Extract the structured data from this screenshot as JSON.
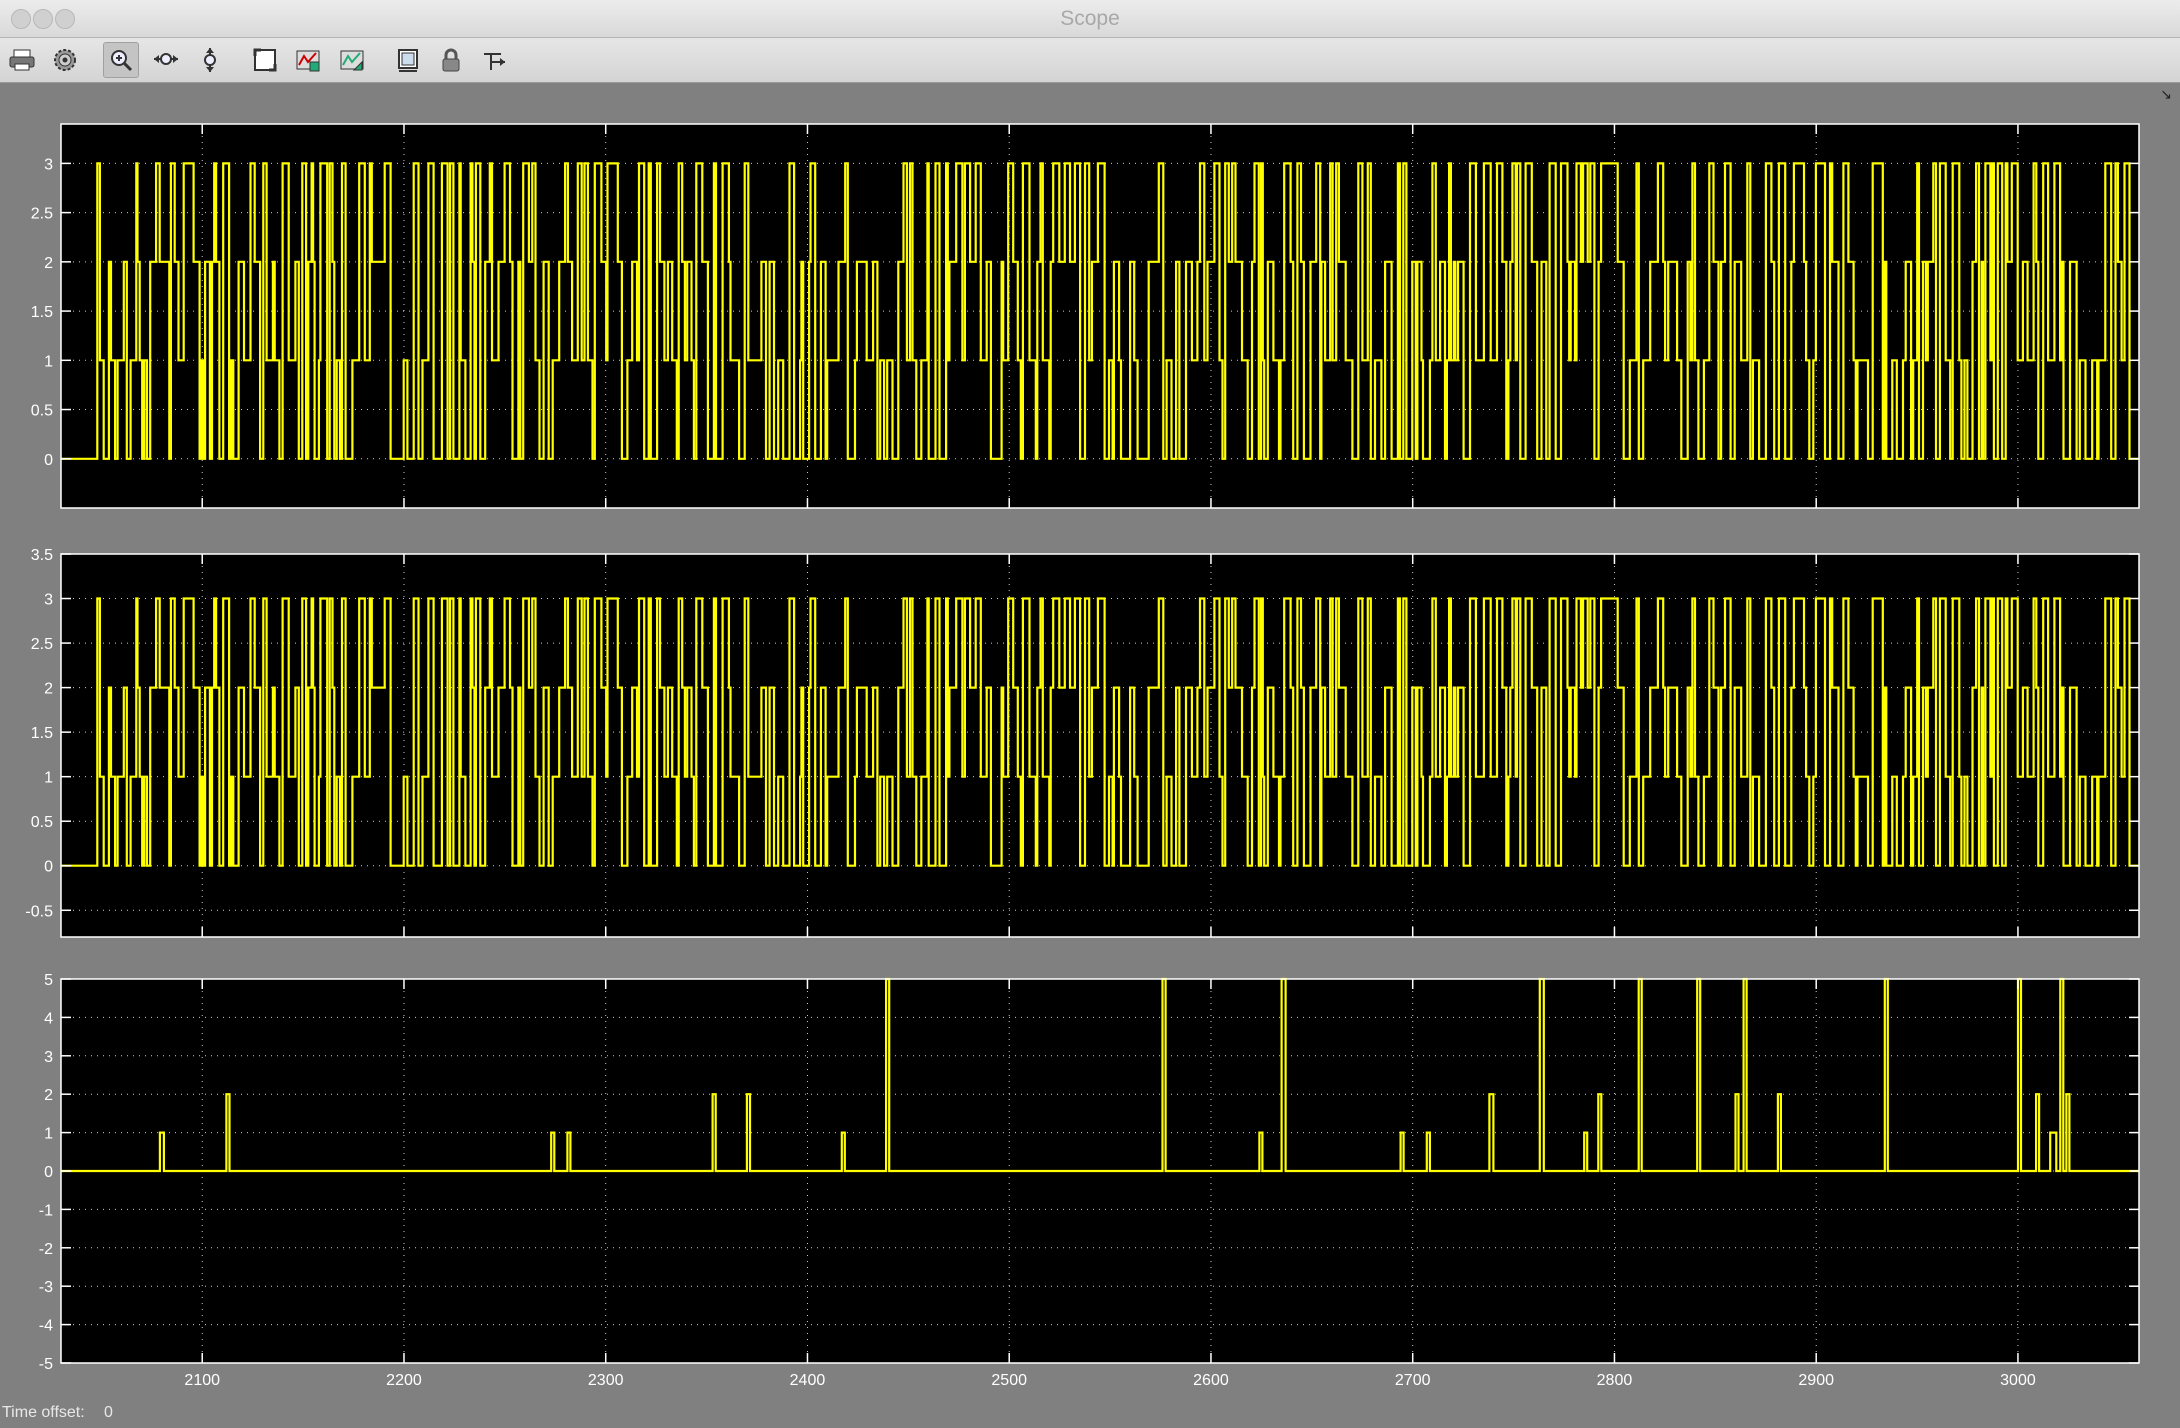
{
  "window": {
    "title": "Scope"
  },
  "toolbar": {
    "buttons": [
      {
        "id": "print",
        "icon": "printer-icon"
      },
      {
        "id": "parameters",
        "icon": "gear-icon"
      },
      {
        "id": "zoom",
        "icon": "zoom-in-icon",
        "active": true
      },
      {
        "id": "zoom-x",
        "icon": "zoom-x-axis-icon"
      },
      {
        "id": "zoom-y",
        "icon": "zoom-y-axis-icon"
      },
      {
        "id": "autoscale",
        "icon": "autoscale-icon"
      },
      {
        "id": "save-axes",
        "icon": "save-axes-settings-icon"
      },
      {
        "id": "restore-axes",
        "icon": "restore-axes-settings-icon"
      },
      {
        "id": "floating-scope",
        "icon": "floating-scope-icon"
      },
      {
        "id": "lock-axes",
        "icon": "lock-icon"
      },
      {
        "id": "signal-selection",
        "icon": "signal-selection-icon"
      }
    ],
    "more_icon": "overflow-arrow-icon"
  },
  "status": {
    "time_offset_label": "Time offset:",
    "time_offset_value": "0"
  },
  "colors": {
    "trace": "#ffff00",
    "axes_bg": "#000000",
    "figure_bg": "#808080",
    "grid": "#ffffff"
  },
  "chart_data": [
    {
      "type": "line",
      "title": "",
      "xlabel": "",
      "ylabel": "",
      "xlim": [
        2030,
        3060
      ],
      "ylim": [
        -0.5,
        3.4
      ],
      "xticks": [
        2100,
        2200,
        2300,
        2400,
        2500,
        2600,
        2700,
        2800,
        2900,
        3000
      ],
      "yticks": [
        0,
        0.5,
        1,
        1.5,
        2,
        2.5,
        3
      ],
      "ytick_labels": [
        "0",
        "0.5",
        "1",
        "1.5",
        "2",
        "2.5",
        "3"
      ],
      "show_xtick_labels": false,
      "grid": true,
      "step": true,
      "signal": {
        "description_free": true,
        "x_start": 2030,
        "x_end": 3060,
        "zero_until": 2048,
        "levels": [
          0,
          1,
          2,
          3
        ],
        "seed": 17
      }
    },
    {
      "type": "line",
      "title": "",
      "xlabel": "",
      "ylabel": "",
      "xlim": [
        2030,
        3060
      ],
      "ylim": [
        -0.8,
        3.5
      ],
      "xticks": [
        2100,
        2200,
        2300,
        2400,
        2500,
        2600,
        2700,
        2800,
        2900,
        3000
      ],
      "yticks": [
        -0.5,
        0,
        0.5,
        1,
        1.5,
        2,
        2.5,
        3,
        3.5
      ],
      "ytick_labels": [
        "-0.5",
        "0",
        "0.5",
        "1",
        "1.5",
        "2",
        "2.5",
        "3",
        "3.5"
      ],
      "show_xtick_labels": false,
      "grid": true,
      "step": true,
      "signal": {
        "x_start": 2030,
        "x_end": 3060,
        "zero_until": 2048,
        "levels": [
          0,
          1,
          2,
          3
        ],
        "seed": 17
      }
    },
    {
      "type": "line",
      "title": "",
      "xlabel": "",
      "ylabel": "",
      "xlim": [
        2030,
        3060
      ],
      "ylim": [
        -5,
        5
      ],
      "xticks": [
        2100,
        2200,
        2300,
        2400,
        2500,
        2600,
        2700,
        2800,
        2900,
        3000
      ],
      "xtick_labels": [
        "2100",
        "2200",
        "2300",
        "2400",
        "2500",
        "2600",
        "2700",
        "2800",
        "2900",
        "3000"
      ],
      "yticks": [
        -5,
        -4,
        -3,
        -2,
        -1,
        0,
        1,
        2,
        3,
        4,
        5
      ],
      "ytick_labels": [
        "-5",
        "-4",
        "-3",
        "-2",
        "-1",
        "0",
        "1",
        "2",
        "3",
        "4",
        "5"
      ],
      "show_xtick_labels": true,
      "grid": true,
      "step": true,
      "pulses": [
        {
          "x": 2079,
          "w": 2,
          "y": 1
        },
        {
          "x": 2112,
          "w": 1.5,
          "y": 2
        },
        {
          "x": 2273,
          "w": 1.5,
          "y": 1
        },
        {
          "x": 2281,
          "w": 1.5,
          "y": 1
        },
        {
          "x": 2353,
          "w": 1.5,
          "y": 2
        },
        {
          "x": 2370,
          "w": 1.5,
          "y": 2
        },
        {
          "x": 2417,
          "w": 1.5,
          "y": 1
        },
        {
          "x": 2439,
          "w": 1.5,
          "y": 5
        },
        {
          "x": 2576,
          "w": 1.5,
          "y": 5
        },
        {
          "x": 2624,
          "w": 1.5,
          "y": 1
        },
        {
          "x": 2635,
          "w": 2,
          "y": 5
        },
        {
          "x": 2694,
          "w": 1.5,
          "y": 1
        },
        {
          "x": 2707,
          "w": 1.5,
          "y": 1
        },
        {
          "x": 2738,
          "w": 2,
          "y": 2
        },
        {
          "x": 2763,
          "w": 2,
          "y": 5
        },
        {
          "x": 2785,
          "w": 1.5,
          "y": 1
        },
        {
          "x": 2792,
          "w": 1.5,
          "y": 2
        },
        {
          "x": 2812,
          "w": 1.5,
          "y": 5
        },
        {
          "x": 2841,
          "w": 1.5,
          "y": 5
        },
        {
          "x": 2860,
          "w": 1.5,
          "y": 2
        },
        {
          "x": 2864,
          "w": 1.5,
          "y": 5
        },
        {
          "x": 2881,
          "w": 1.5,
          "y": 2
        },
        {
          "x": 2934,
          "w": 1.5,
          "y": 5
        },
        {
          "x": 3000,
          "w": 1.5,
          "y": 5
        },
        {
          "x": 3009,
          "w": 1.5,
          "y": 2
        },
        {
          "x": 3016,
          "w": 3,
          "y": 1
        },
        {
          "x": 3021,
          "w": 1.5,
          "y": 5
        },
        {
          "x": 3024,
          "w": 1.5,
          "y": 2
        }
      ]
    }
  ]
}
